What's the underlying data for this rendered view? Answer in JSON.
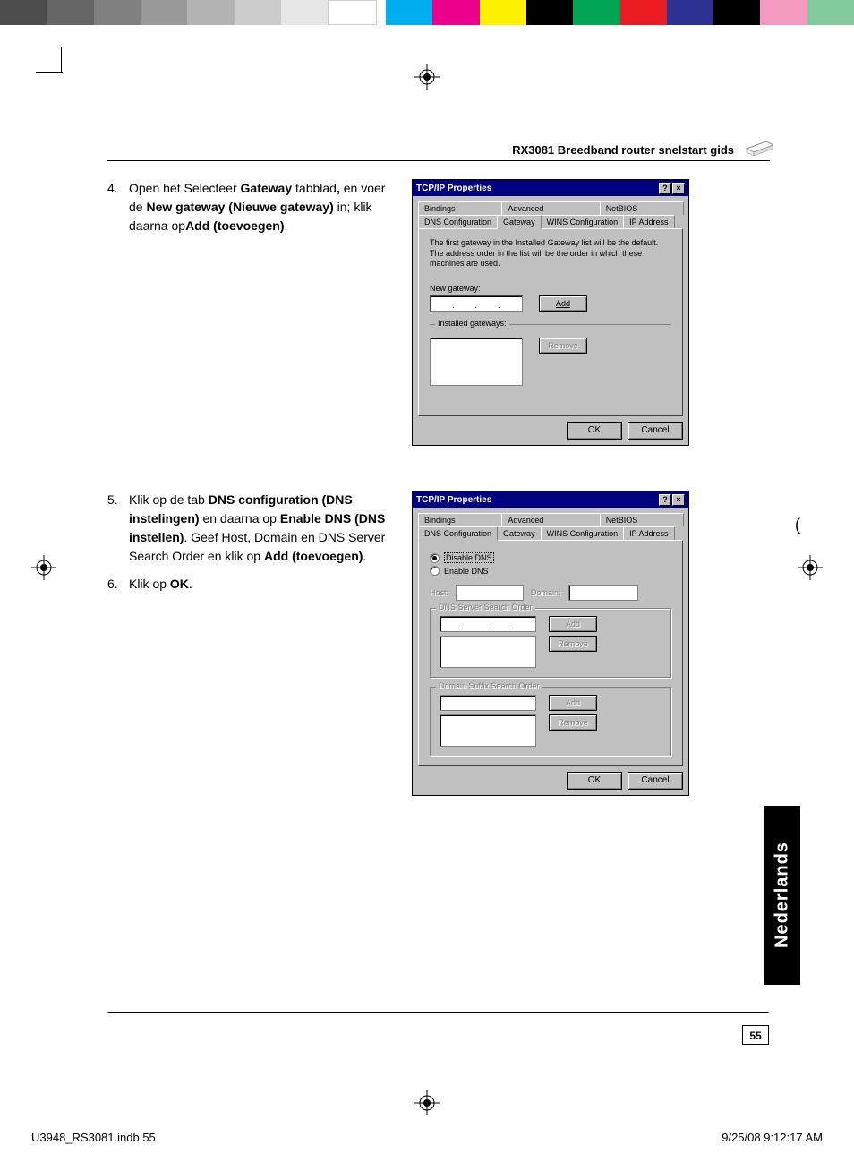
{
  "colorbar": [
    "#4d4d4d",
    "#666666",
    "#808080",
    "#999999",
    "#b3b3b3",
    "#cccccc",
    "#e6e6e6",
    "#ffffff",
    "#00aeef",
    "#ec008c",
    "#fff200",
    "#000000",
    "#00a651",
    "#ed1c24",
    "#2e3192",
    "#000000",
    "#f49ac1",
    "#82ca9c",
    "#fff"
  ],
  "header": {
    "title": "RX3081 Breedband router snelstart gids"
  },
  "steps": {
    "s4": {
      "num": "4.",
      "pre": "Open het Selecteer ",
      "b1": "Gateway",
      "mid1": " tabblad",
      "comma": ",",
      "mid2": " en voer de  ",
      "b2": "New gateway (Nieuwe gateway)",
      "mid3": " in; klik daarna op",
      "b3": "Add (toevoegen)",
      "end": "."
    },
    "s5": {
      "num": "5.",
      "pre": "Klik op de tab ",
      "b1": "DNS configuration (DNS instelingen)",
      "mid1": " en daarna op ",
      "b2": "Enable DNS (DNS instellen)",
      "mid2": ". Geef Host, Domain en DNS Server Search Order en klik op ",
      "b3": "Add (toevoegen)",
      "end": "."
    },
    "s6": {
      "num": "6.",
      "pre": "Klik op ",
      "b1": "OK",
      "end": "."
    }
  },
  "dialog": {
    "title": "TCP/IP Properties",
    "help": "?",
    "close": "×",
    "tabs_row1": [
      "Bindings",
      "Advanced",
      "NetBIOS"
    ],
    "tabs_row2": [
      "DNS Configuration",
      "Gateway",
      "WINS Configuration",
      "IP Address"
    ],
    "ok": "OK",
    "cancel": "Cancel"
  },
  "gateway_panel": {
    "desc": "The first gateway in the Installed Gateway list will be the default. The address order in the list will be the order in which these machines are used.",
    "new_gateway": "New gateway:",
    "add": "Add",
    "installed": "Installed gateways:",
    "remove": "Remove"
  },
  "dns_panel": {
    "disable": "Disable DNS",
    "enable": "Enable DNS",
    "host": "Host:",
    "domain": "Domain:",
    "search_order": "DNS Server Search Order",
    "domain_suffix": "Domain Suffix Search Order",
    "add": "Add",
    "remove": "Remove"
  },
  "stray_paren": "(",
  "lang": "Nederlands",
  "page_number": "55",
  "print_footer": {
    "left": "U3948_RS3081.indb   55",
    "right": "9/25/08   9:12:17 AM"
  }
}
